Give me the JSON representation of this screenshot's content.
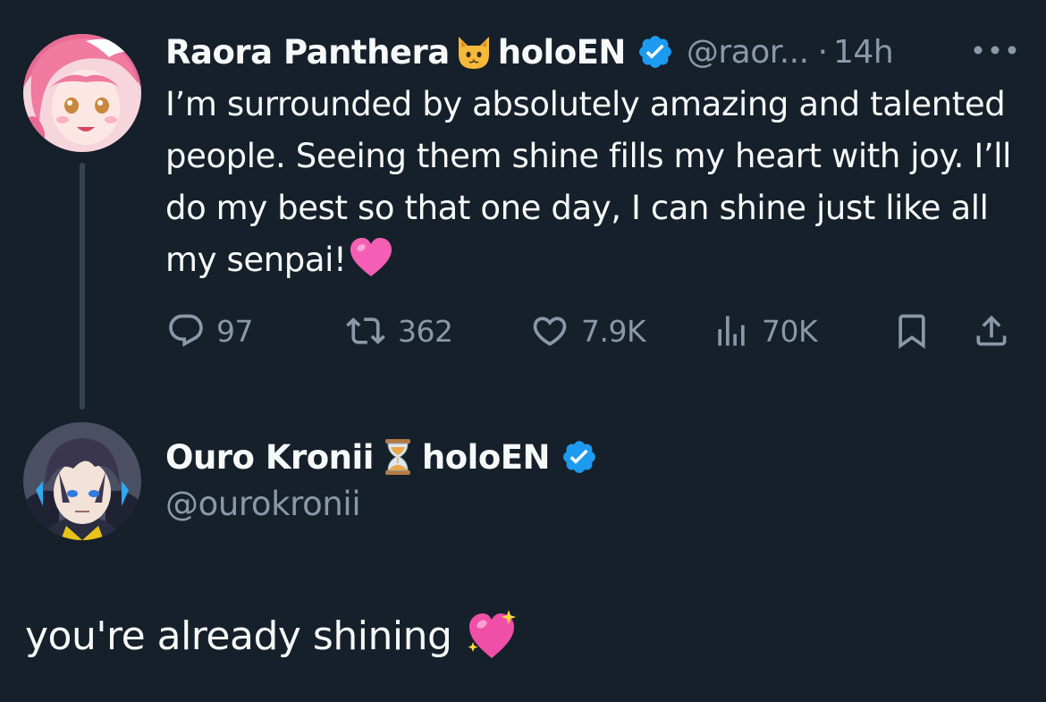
{
  "original_tweet": {
    "display_name": "Raora Panthera",
    "name_emoji": "cat-face-emoji",
    "affiliation": "holoEN",
    "handle": "@raor...",
    "separator": "·",
    "timestamp": "14h",
    "text": "I’m surrounded by absolutely amazing and talented people. Seeing them shine fills my heart with joy. I’ll do my best so that one day, I can shine just like all my senpai!",
    "text_emoji": "pink-heart-emoji",
    "stats": {
      "replies": "97",
      "retweets": "362",
      "likes": "7.9K",
      "views": "70K"
    }
  },
  "reply_author": {
    "display_name": "Ouro Kronii",
    "name_emoji": "hourglass-emoji",
    "affiliation": "holoEN",
    "handle": "@ourokronii"
  },
  "reply": {
    "text": "you're already shining",
    "emoji": "sparkling-heart-emoji"
  },
  "colors": {
    "background": "#15202b",
    "primary_text": "#f7f9f9",
    "secondary_text": "#8b98a5",
    "verified_blue": "#1d9bf0",
    "thread_line": "#38444d"
  }
}
